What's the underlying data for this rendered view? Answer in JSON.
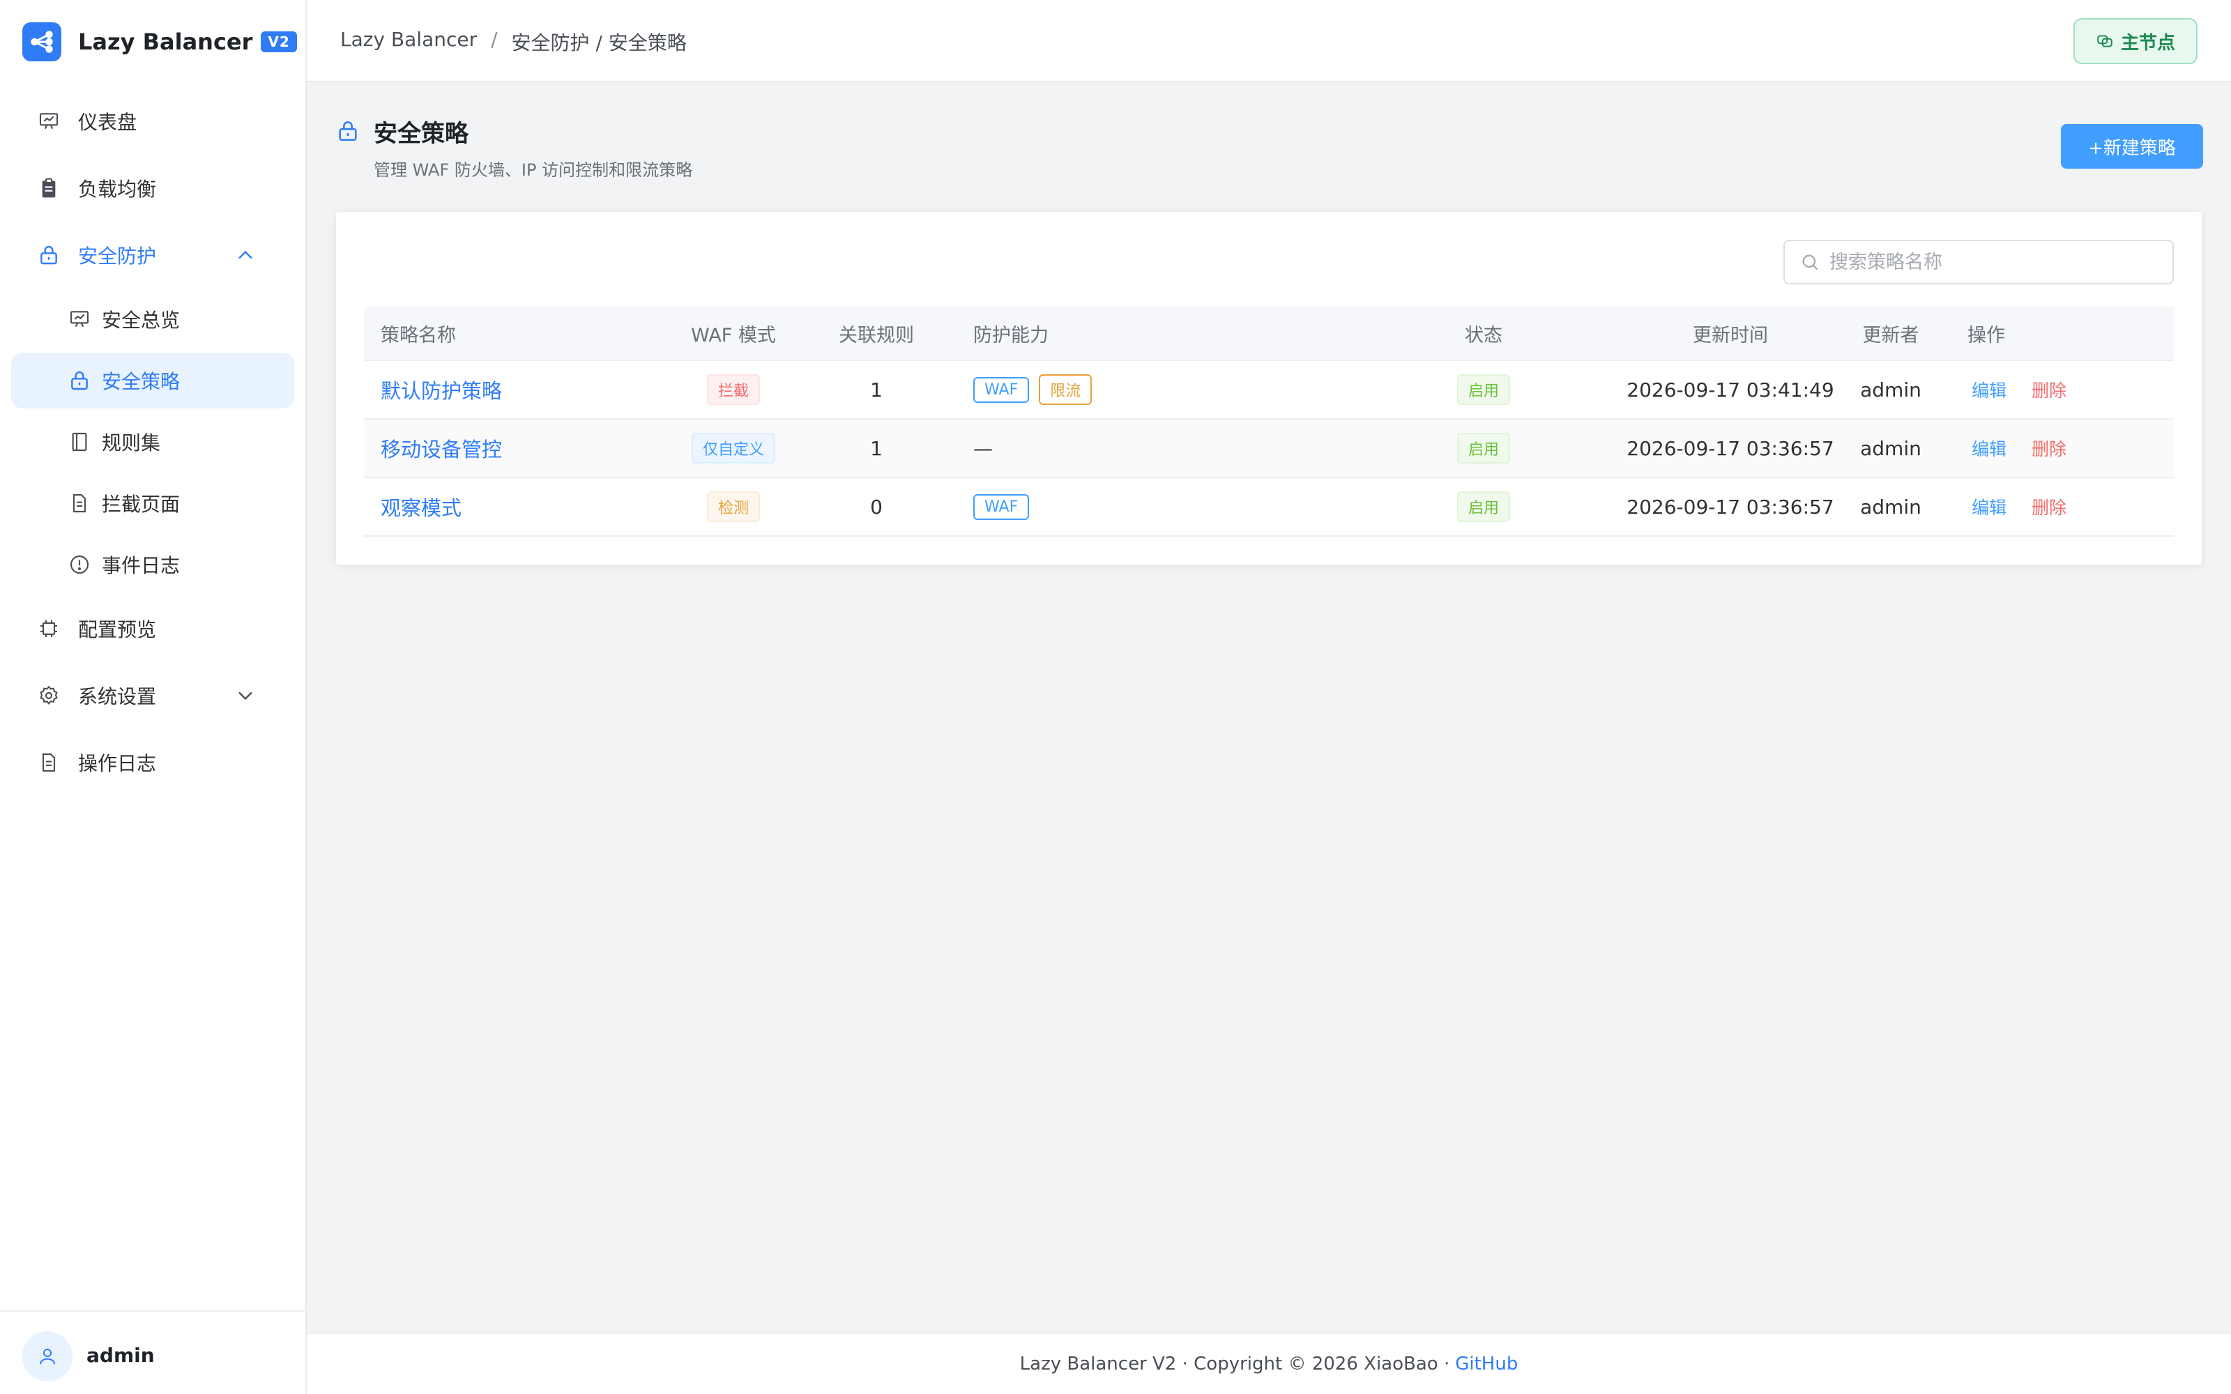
{
  "app": {
    "name": "Lazy Balancer",
    "badge": "V2"
  },
  "sidebar": {
    "items": [
      {
        "label": "仪表盘",
        "icon": "dashboard-icon"
      },
      {
        "label": "负载均衡",
        "icon": "clipboard-icon"
      },
      {
        "label": "安全防护",
        "icon": "lock-icon",
        "expanded": true
      },
      {
        "label": "安全总览",
        "icon": "dashboard-icon"
      },
      {
        "label": "安全策略",
        "icon": "lock-icon",
        "active": true
      },
      {
        "label": "规则集",
        "icon": "notebook-icon"
      },
      {
        "label": "拦截页面",
        "icon": "document-icon"
      },
      {
        "label": "事件日志",
        "icon": "warning-circle-icon"
      },
      {
        "label": "配置预览",
        "icon": "cpu-icon"
      },
      {
        "label": "系统设置",
        "icon": "gear-icon",
        "expanded": false
      },
      {
        "label": "操作日志",
        "icon": "document-icon"
      }
    ]
  },
  "user": {
    "name": "admin"
  },
  "header": {
    "breadcrumb": [
      "Lazy Balancer",
      "安全防护 / 安全策略"
    ],
    "node_label": "主节点"
  },
  "page": {
    "title": "安全策略",
    "subtitle": "管理 WAF 防火墙、IP 访问控制和限流策略",
    "new_button": "+新建策略"
  },
  "search": {
    "placeholder": "搜索策略名称"
  },
  "table": {
    "columns": [
      "策略名称",
      "WAF 模式",
      "关联规则",
      "防护能力",
      "状态",
      "更新时间",
      "更新者",
      "操作"
    ],
    "rows": [
      {
        "name": "默认防护策略",
        "waf_mode": "拦截",
        "rules": "1",
        "cap1": "WAF",
        "cap2": "限流",
        "status": "启用",
        "updated": "2026-09-17 03:41:49",
        "updater": "admin",
        "edit": "编辑",
        "delete": "删除"
      },
      {
        "name": "移动设备管控",
        "waf_mode": "仅自定义",
        "rules": "1",
        "cap_none": "—",
        "status": "启用",
        "updated": "2026-09-17 03:36:57",
        "updater": "admin",
        "edit": "编辑",
        "delete": "删除"
      },
      {
        "name": "观察模式",
        "waf_mode": "检测",
        "rules": "0",
        "cap1": "WAF",
        "status": "启用",
        "updated": "2026-09-17 03:36:57",
        "updater": "admin",
        "edit": "编辑",
        "delete": "删除"
      }
    ]
  },
  "footer": {
    "text": "Lazy Balancer V2 · Copyright © 2026 XiaoBao ·",
    "link": "GitHub"
  },
  "colors": {
    "primary": "#2f7cf6",
    "danger": "#f56c6c",
    "warning": "#e6a23c",
    "success": "#67c23a"
  }
}
